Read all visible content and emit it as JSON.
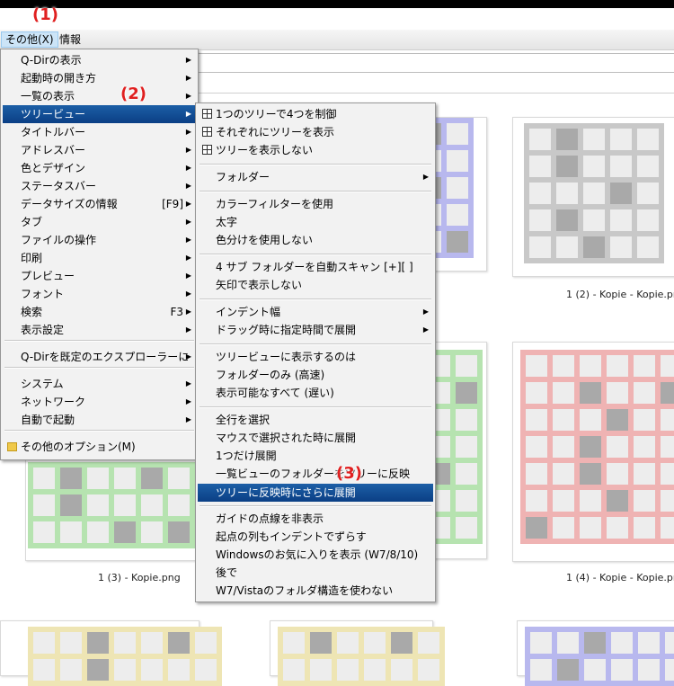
{
  "menubar": {
    "items": [
      "その他(X)",
      "情報"
    ]
  },
  "annotations": [
    "(1)",
    "(2)",
    "(3)"
  ],
  "main_menu": {
    "items": [
      {
        "label": "Q-Dirの表示",
        "arrow": true
      },
      {
        "label": "起動時の開き方",
        "arrow": true
      },
      {
        "label": "一覧の表示",
        "arrow": true
      },
      {
        "label": "ツリービュー",
        "arrow": true,
        "highlighted": true
      },
      {
        "label": "タイトルバー",
        "arrow": true
      },
      {
        "label": "アドレスバー",
        "arrow": true
      },
      {
        "label": "色とデザイン",
        "arrow": true
      },
      {
        "label": "ステータスバー",
        "arrow": true
      },
      {
        "label": "データサイズの情報",
        "shortcut": "[F9]",
        "arrow": true
      },
      {
        "label": "タブ",
        "arrow": true
      },
      {
        "label": "ファイルの操作",
        "arrow": true
      },
      {
        "label": "印刷",
        "arrow": true
      },
      {
        "label": "プレビュー",
        "arrow": true
      },
      {
        "label": "フォント",
        "arrow": true
      },
      {
        "label": "検索",
        "shortcut": "F3",
        "arrow": true
      },
      {
        "label": "表示設定",
        "arrow": true
      },
      {
        "label": "Q-Dirを既定のエクスプローラーに",
        "arrow": true
      },
      {
        "label": "システム",
        "arrow": true
      },
      {
        "label": "ネットワーク",
        "arrow": true
      },
      {
        "label": "自動で起動",
        "arrow": true
      },
      {
        "label": "その他のオプション(M)",
        "icon": "folder-icon"
      }
    ]
  },
  "sub_menu": {
    "items": [
      {
        "label": "1つのツリーで4つを制御",
        "icon": "tree-icon"
      },
      {
        "label": "それぞれにツリーを表示",
        "icon": "tree-icon"
      },
      {
        "label": "ツリーを表示しない",
        "icon": "tree-icon"
      },
      {
        "label": "フォルダー",
        "arrow": true
      },
      {
        "label": "カラーフィルターを使用"
      },
      {
        "label": "太字"
      },
      {
        "label": "色分けを使用しない"
      },
      {
        "label": "4 サブ フォルダーを自動スキャン [+][ ]"
      },
      {
        "label": "矢印で表示しない"
      },
      {
        "label": "インデント幅",
        "arrow": true
      },
      {
        "label": "ドラッグ時に指定時間で展開",
        "arrow": true
      },
      {
        "label": "ツリービューに表示するのは"
      },
      {
        "label": "フォルダーのみ (高速)"
      },
      {
        "label": "表示可能なすべて (遅い)"
      },
      {
        "label": "全行を選択"
      },
      {
        "label": "マウスで選択された時に展開"
      },
      {
        "label": "1つだけ展開"
      },
      {
        "label": "一覧ビューのフォルダーをツリーに反映"
      },
      {
        "label": "ツリーに反映時にさらに展開",
        "highlighted": true
      },
      {
        "label": "ガイドの点線を非表示"
      },
      {
        "label": "起点の列もインデントでずらす"
      },
      {
        "label": "Windowsのお気に入りを表示 (W7/8/10)"
      },
      {
        "label": "後で"
      },
      {
        "label": "W7/Vistaのフォルダ構造を使わない"
      }
    ]
  },
  "files": [
    {
      "caption": "1 (2) - Kopie - Kopie.png",
      "color": "#c8c8c8"
    },
    {
      "caption": "1 (3) - Kopie.png",
      "color": "#b6e3b0"
    },
    {
      "caption": "1 (4) - Kopie - Kopie.png",
      "color": "#efb3b3"
    }
  ],
  "thumb_colors": {
    "blue": "#b8b8ee",
    "green": "#b6e3b0",
    "yellow": "#eee5b4",
    "gray": "#c8c8c8",
    "red": "#efb3b3"
  }
}
